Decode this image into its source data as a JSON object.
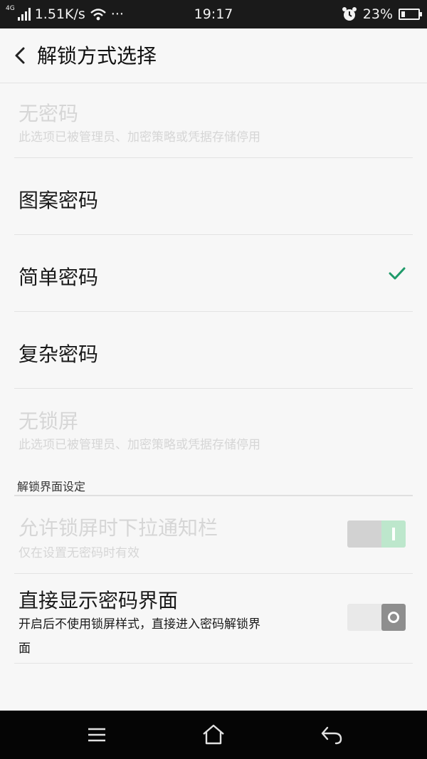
{
  "status_bar": {
    "network_type": "4G",
    "speed": "1.51K/s",
    "more": "···",
    "time": "19:17",
    "battery": "23%",
    "battery_level": 0.23,
    "icons": [
      "signal-icon",
      "wifi-icon",
      "alarm-icon",
      "battery-icon"
    ]
  },
  "header": {
    "back_icon": "back-arrow-icon",
    "title": "解锁方式选择"
  },
  "options": [
    {
      "label": "无密码",
      "sub": "此选项已被管理员、加密策略或凭据存储停用",
      "disabled": true
    },
    {
      "label": "图案密码"
    },
    {
      "label": "简单密码",
      "selected": true
    },
    {
      "label": "复杂密码"
    },
    {
      "label": "无锁屏",
      "sub": "此选项已被管理员、加密策略或凭据存储停用",
      "disabled": true
    }
  ],
  "section": {
    "header": "解锁界面设定",
    "items": [
      {
        "label": "允许锁屏时下拉通知栏",
        "sub": "仅在设置无密码时有效",
        "disabled": true,
        "on": true
      },
      {
        "label": "直接显示密码界面",
        "sub_line1": "开启后不使用锁屏样式，直接进入密码解锁界",
        "sub_line2": "面",
        "on": false
      }
    ]
  },
  "colors": {
    "accent_green": "#1f9a6a",
    "status_bar_bg": "#1a1a1a",
    "nav_bar_bg": "#050505",
    "page_bg": "#f7f7f7",
    "disabled_text": "#d6d6d6"
  },
  "nav_bar": {
    "icons": [
      "menu-icon",
      "home-icon",
      "back-icon"
    ]
  }
}
